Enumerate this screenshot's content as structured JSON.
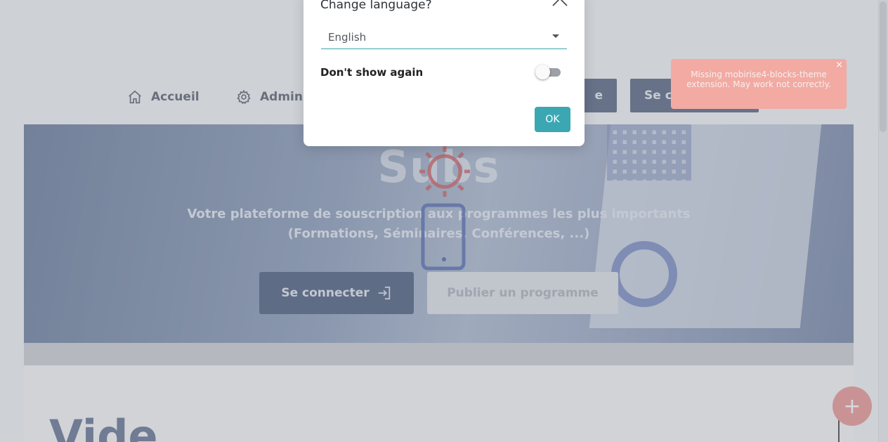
{
  "nav": {
    "home_label": "Accueil",
    "admin_label": "Admin",
    "button_partial_label": "e",
    "connect_partial_label": "Se co"
  },
  "hero": {
    "title": "Subs",
    "subtitle_line1": "Votre plateforme de souscription aux programmes les plus importants",
    "subtitle_line2": "(Formations, Séminaires, Conférences, ...)",
    "connect_button": "Se connecter",
    "publish_button": "Publier un programme"
  },
  "section": {
    "title": "Vide"
  },
  "fab": {
    "symbol": "+"
  },
  "toast": {
    "message": "Missing mobirise4-blocks-theme extension. May work not correctly.",
    "close_symbol": "×"
  },
  "modal": {
    "title": "Change language?",
    "language_value": "English",
    "dont_show_label": "Don't show again",
    "dont_show_enabled": false,
    "ok_label": "OK"
  },
  "colors": {
    "accent": "#3ba7b3",
    "toast_bg": "#f2aaa2",
    "loader_sun": "#c94a52",
    "loader_phone": "#3e57a6"
  },
  "icons": {
    "home": "home-icon",
    "admin": "gear-icon",
    "login": "login-arrow-icon",
    "close": "chevron-up-icon",
    "dropdown": "caret-down-icon"
  }
}
